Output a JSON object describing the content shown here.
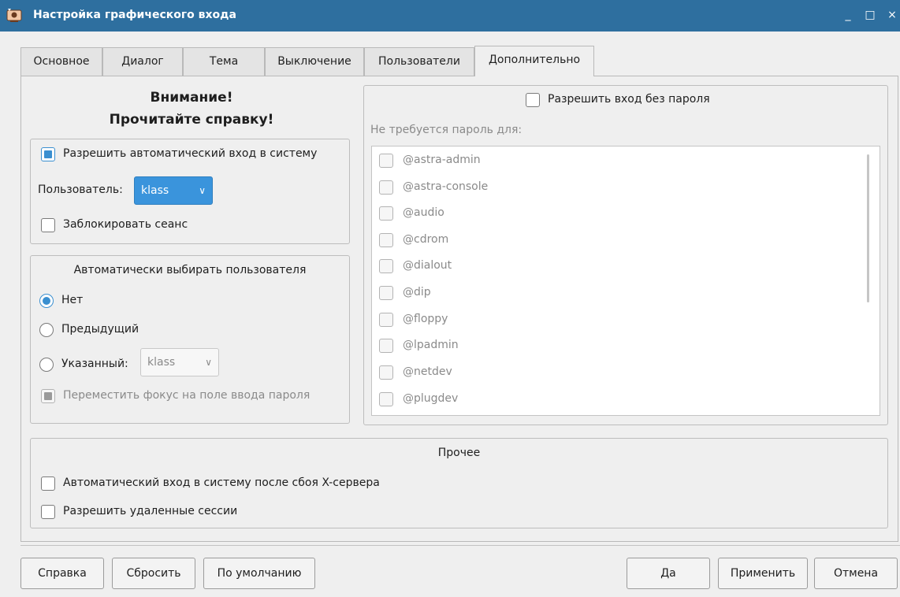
{
  "window": {
    "title": "Настройка графического входа",
    "minimize": "_",
    "maximize": "□",
    "close": "×",
    "title_bar_color": "#2e6f9f"
  },
  "tabs": [
    "Основное",
    "Диалог",
    "Тема",
    "Выключение",
    "Пользователи",
    "Дополнительно"
  ],
  "active_tab": "Дополнительно",
  "warning": {
    "line1": "Внимание!",
    "line2": "Прочитайте справку!"
  },
  "autologin": {
    "enable_label": "Разрешить автоматический вход в систему",
    "enabled": true,
    "user_label": "Пользователь:",
    "user_value": "klass",
    "lock_label": "Заблокировать сеанс",
    "lock": false
  },
  "preselect": {
    "title": "Автоматически выбирать пользователя",
    "none_label": "Нет",
    "prev_label": "Предыдущий",
    "specified_label": "Указанный:",
    "specified_value": "klass",
    "selected": "none",
    "focus_label": "Переместить фокус на поле ввода пароля",
    "focus_checked": true
  },
  "nopass": {
    "enable_label": "Разрешить вход без пароля",
    "enabled": false,
    "list_label": "Не требуется пароль для:",
    "items": [
      "@astra-admin",
      "@astra-console",
      "@audio",
      "@cdrom",
      "@dialout",
      "@dip",
      "@floppy",
      "@lpadmin",
      "@netdev",
      "@plugdev"
    ]
  },
  "misc": {
    "title": "Прочее",
    "crash_label": "Автоматический вход в систему после сбоя X-сервера",
    "remote_label": "Разрешить удаленные сессии"
  },
  "buttons": {
    "help": "Справка",
    "reset": "Сбросить",
    "defaults": "По умолчанию",
    "ok": "Да",
    "apply": "Применить",
    "cancel": "Отмена"
  },
  "colors": {
    "accent": "#3a94dc"
  }
}
